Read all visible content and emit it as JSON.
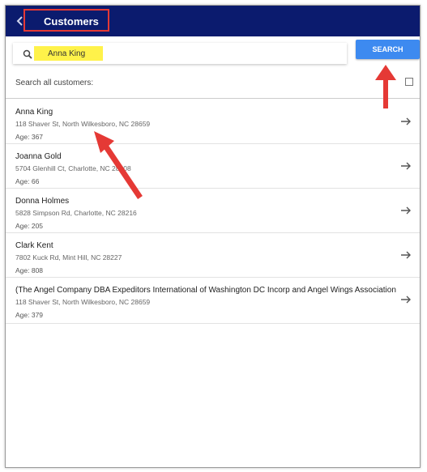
{
  "header": {
    "title": "Customers",
    "back_icon": "arrow-left-icon"
  },
  "search": {
    "value": "Anna King",
    "placeholder": "",
    "button_label": "SEARCH"
  },
  "filter": {
    "label": "Search all customers:",
    "checked": false
  },
  "customers": [
    {
      "name": "Anna King",
      "address": "118 Shaver St, North Wilkesboro, NC 28659",
      "age": "Age: 367"
    },
    {
      "name": "Joanna Gold",
      "address": "5704 Glenhill Ct, Charlotte, NC 28208",
      "age": "Age: 66"
    },
    {
      "name": "Donna Holmes",
      "address": "5828 Simpson Rd, Charlotte, NC 28216",
      "age": "Age: 205"
    },
    {
      "name": "Clark Kent",
      "address": "7802 Kuck Rd, Mint Hill, NC 28227",
      "age": "Age: 808"
    },
    {
      "name": "(The Angel Company DBA Expeditors International of Washington DC Incorp and Angel Wings Association",
      "address": "118 Shaver St, North Wilkesboro, NC 28659",
      "age": "Age: 379"
    }
  ],
  "colors": {
    "header_bg": "#0b1b6e",
    "button_bg": "#3d8af0",
    "highlight": "#fff24a",
    "annotation_red": "#e53935"
  }
}
